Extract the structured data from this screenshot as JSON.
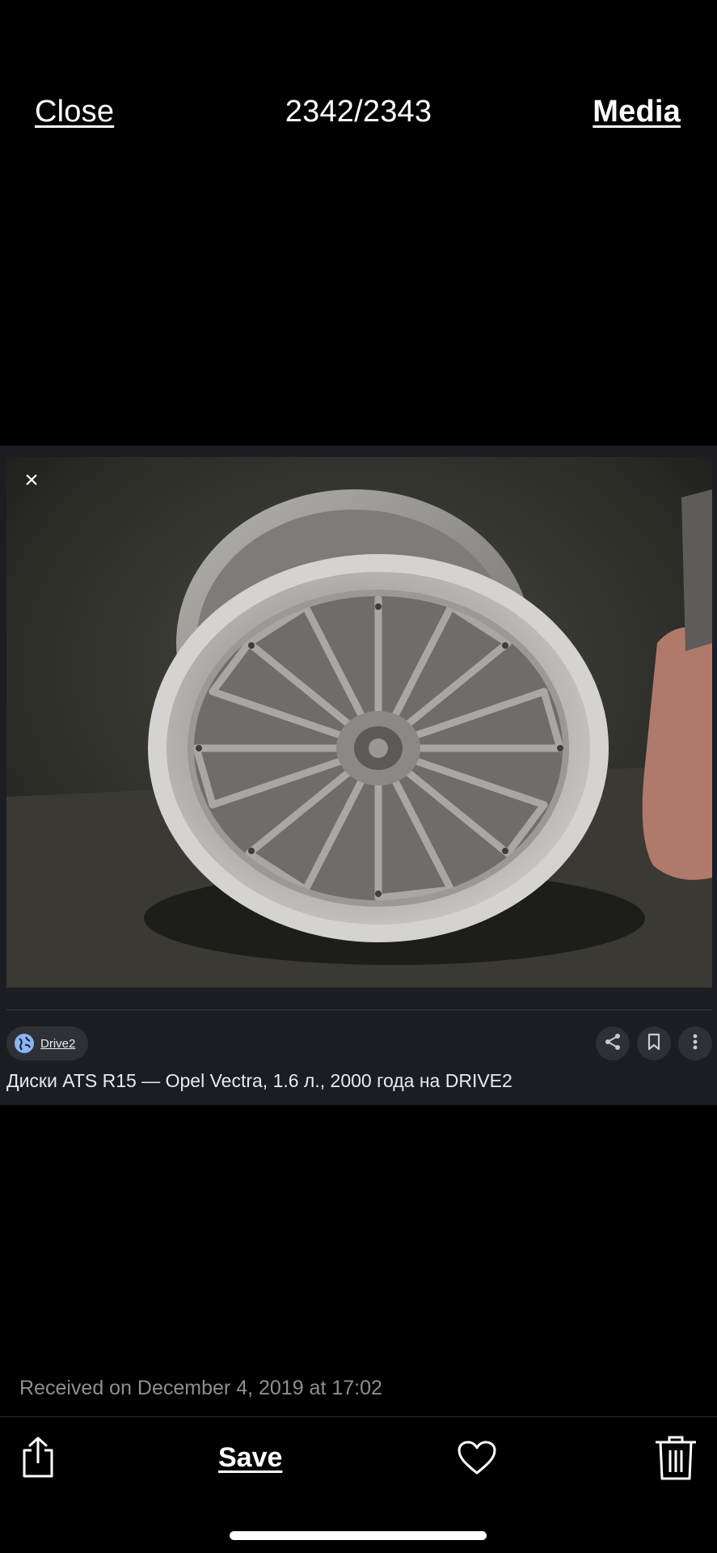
{
  "header": {
    "close_label": "Close",
    "counter": "2342/2343",
    "media_label": "Media"
  },
  "card": {
    "close_glyph": "×",
    "source_label": "Drive2",
    "title": "Диски ATS R15 — Opel Vectra, 1.6 л., 2000 года на DRIVE2",
    "icons": [
      "globe-icon",
      "share-icon",
      "bookmark-icon",
      "more-vertical-icon"
    ]
  },
  "footer": {
    "received_text": "Received on December 4, 2019 at 17:02",
    "save_label": "Save",
    "icons": [
      "share-icon",
      "heart-icon",
      "trash-icon"
    ]
  },
  "colors": {
    "background": "#000000",
    "card_background": "#1c1d22",
    "chip_background": "#2f3035",
    "muted_text": "#8e8e93",
    "globe_accent": "#8ab4f8"
  }
}
